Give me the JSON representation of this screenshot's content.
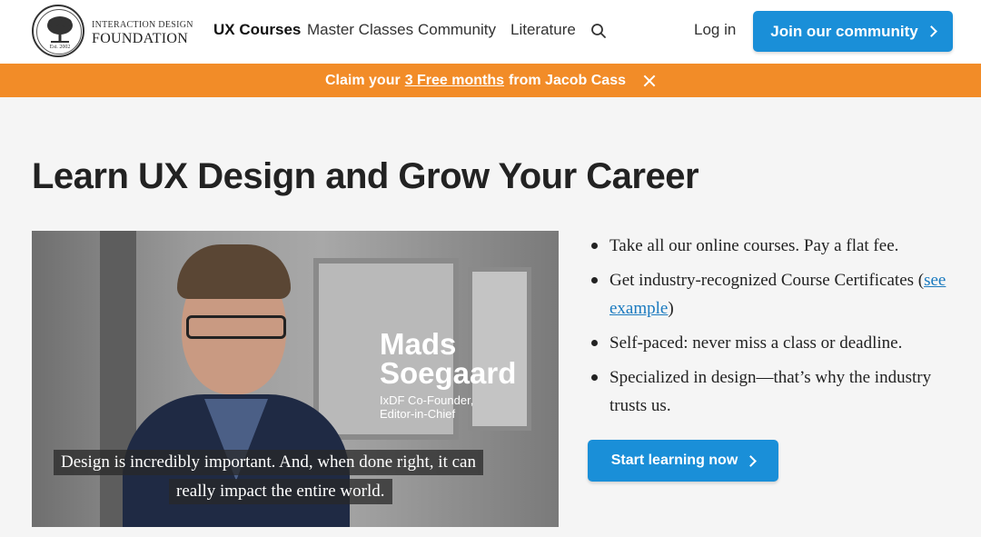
{
  "logo": {
    "line1": "INTERACTION DESIGN",
    "line2": "FOUNDATION",
    "est": "Est. 2002"
  },
  "nav": {
    "items": [
      {
        "label": "UX Courses",
        "active": true
      },
      {
        "label": "Master Classes",
        "active": false
      },
      {
        "label": "Community",
        "active": false
      },
      {
        "label": "Literature",
        "active": false
      }
    ],
    "search_icon": "search-icon"
  },
  "header": {
    "login": "Log in",
    "join_label": "Join our community"
  },
  "promo": {
    "prefix": "Claim your",
    "link": "3 Free months",
    "suffix": "from Jacob Cass",
    "close_icon": "close-icon",
    "color": "#f28c28"
  },
  "main": {
    "title": "Learn UX Design and Grow Your Career",
    "video": {
      "name_first": "Mads",
      "name_last": "Soegaard",
      "role_line1": "IxDF Co-Founder,",
      "role_line2": "Editor-in-Chief",
      "caption_line1": "Design is incredibly important. And, when done right, it can",
      "caption_line2": "really impact the entire world."
    },
    "benefits": {
      "item1": "Take all our online courses. Pay a flat fee.",
      "item2_text": "Get industry-recognized Course Certificates (",
      "item2_link": "see example",
      "item2_close": ")",
      "item3": "Self-paced: never miss a class or deadline.",
      "item4": "Specialized in design—that’s why the industry trusts us."
    },
    "cta_label": "Start learning now"
  },
  "colors": {
    "accent": "#1a8fd8",
    "banner": "#f28c28",
    "background": "#f5f5f5"
  }
}
